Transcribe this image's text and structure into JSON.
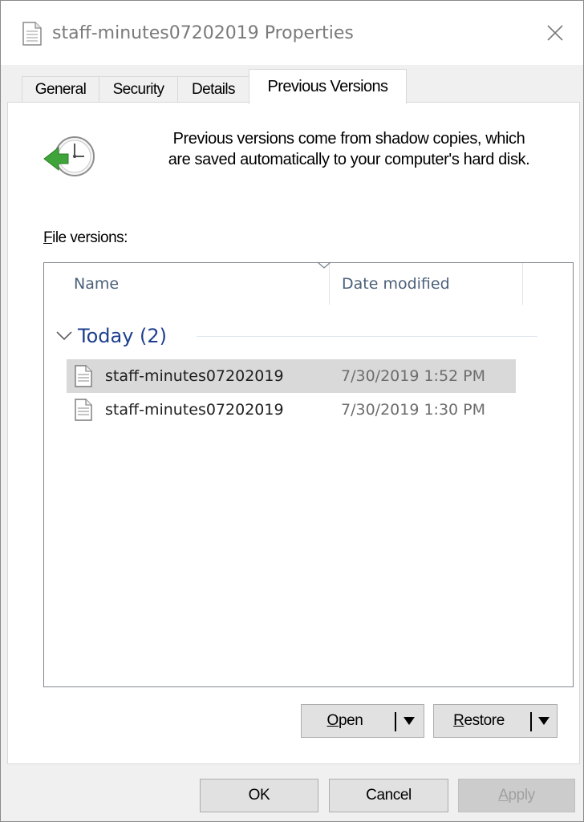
{
  "window": {
    "title": "staff-minutes07202019 Properties",
    "close_glyph": "✕"
  },
  "tabs": [
    {
      "label": "General",
      "active": false
    },
    {
      "label": "Security",
      "active": false
    },
    {
      "label": "Details",
      "active": false
    },
    {
      "label": "Previous Versions",
      "active": true
    }
  ],
  "info": {
    "line1": "Previous versions come from shadow copies, which",
    "line2": "are saved automatically to your computer's hard disk."
  },
  "versions": {
    "label_accel": "F",
    "label_rest": "ile versions:",
    "columns": [
      "Name",
      "Date modified"
    ],
    "group": {
      "expander": "chevron-down-icon",
      "title": "Today (2)"
    },
    "rows": [
      {
        "name": "staff-minutes07202019",
        "date": "7/30/2019 1:52 PM",
        "selected": true
      },
      {
        "name": "staff-minutes07202019",
        "date": "7/30/2019 1:30 PM",
        "selected": false
      }
    ]
  },
  "actions": {
    "open_accel": "O",
    "open_rest": "pen",
    "restore_accel": "R",
    "restore_rest": "estore"
  },
  "footer": {
    "ok": "OK",
    "cancel": "Cancel",
    "apply_accel": "A",
    "apply_rest": "pply",
    "apply_enabled": false
  },
  "colors": {
    "group_title": "#1e3f8f",
    "column_header": "#4c607a",
    "selection": "#d9d9d9",
    "clock_arrow": "#3fa53a"
  }
}
